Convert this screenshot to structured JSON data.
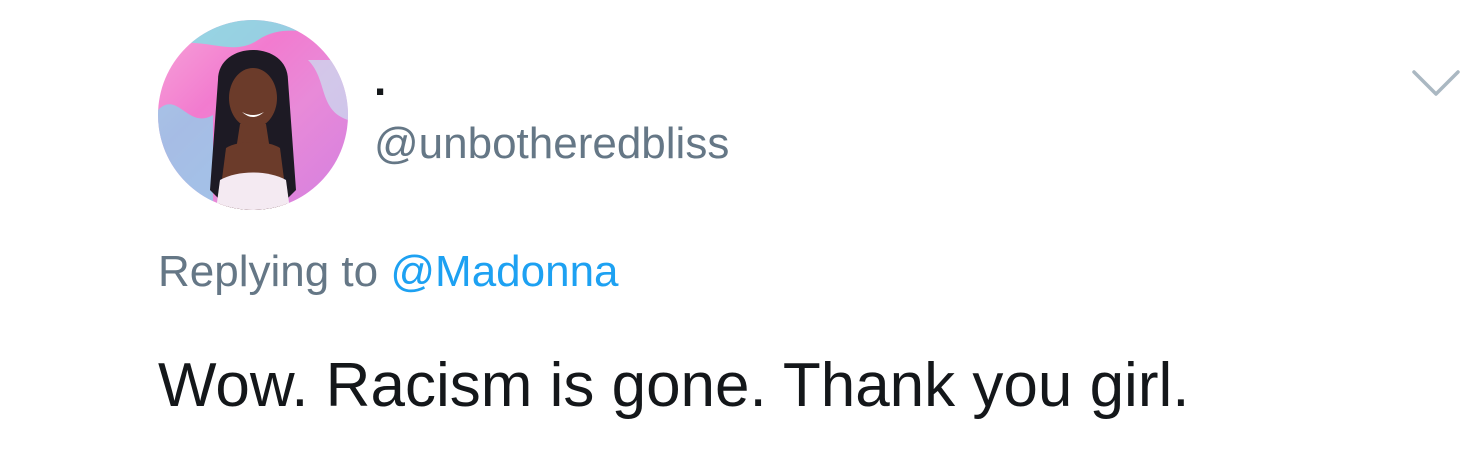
{
  "tweet": {
    "author": {
      "display_name": ".",
      "handle": "@unbotheredbliss"
    },
    "reply": {
      "prefix": "Replying to",
      "mention": "@Madonna"
    },
    "text": "Wow. Racism is gone. Thank you girl."
  },
  "icons": {
    "menu": "chevron-down-icon"
  },
  "colors": {
    "primary_text": "#14171a",
    "secondary_text": "#657786",
    "mention": "#1da1f2",
    "background": "#ffffff"
  }
}
